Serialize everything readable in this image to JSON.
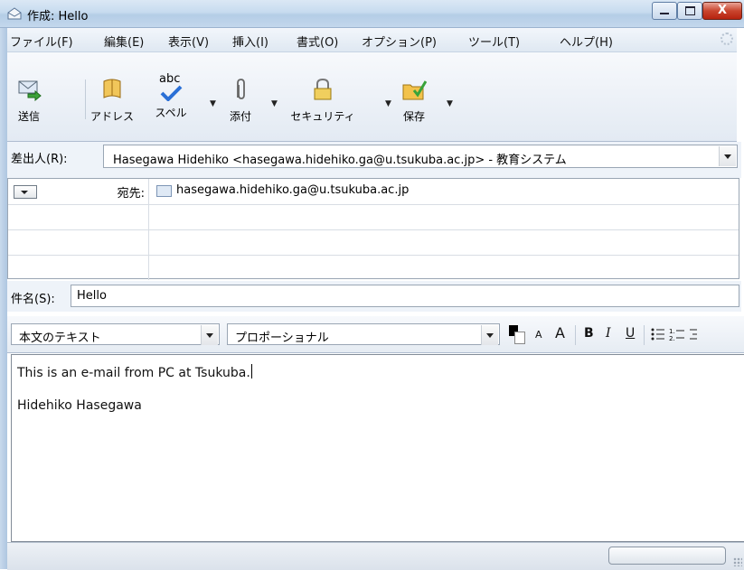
{
  "window": {
    "title": "作成: Hello",
    "controls": {
      "minimize": "",
      "maximize": "",
      "close": "X"
    }
  },
  "menu": {
    "items": [
      "ファイル(F)",
      "編集(E)",
      "表示(V)",
      "挿入(I)",
      "書式(O)",
      "オプション(P)",
      "ツール(T)",
      "ヘルプ(H)"
    ]
  },
  "toolbar": {
    "send": "送信",
    "address": "アドレス",
    "spell": "スペル",
    "spell_icon_text": "abc",
    "attach": "添付",
    "security": "セキュリティ",
    "save": "保存"
  },
  "header": {
    "from_label": "差出人(R):",
    "from_value": "Hasegawa Hidehiko <hasegawa.hidehiko.ga@u.tsukuba.ac.jp>  - 教育システム",
    "recipients": [
      {
        "type": "宛先:",
        "address": "hasegawa.hidehiko.ga@u.tsukuba.ac.jp"
      },
      {
        "type": "",
        "address": ""
      },
      {
        "type": "",
        "address": ""
      },
      {
        "type": "",
        "address": ""
      }
    ],
    "subject_label": "件名(S):",
    "subject_value": "Hello"
  },
  "format": {
    "paragraph_style": "本文のテキスト",
    "font": "プロポーショナル",
    "text_color": "#000000",
    "smaller": "A",
    "larger": "A",
    "bold": "B",
    "italic": "I",
    "underline": "U"
  },
  "body": {
    "lines": [
      "This is an e-mail from PC at Tsukuba.",
      "Hidehiko Hasegawa"
    ]
  }
}
